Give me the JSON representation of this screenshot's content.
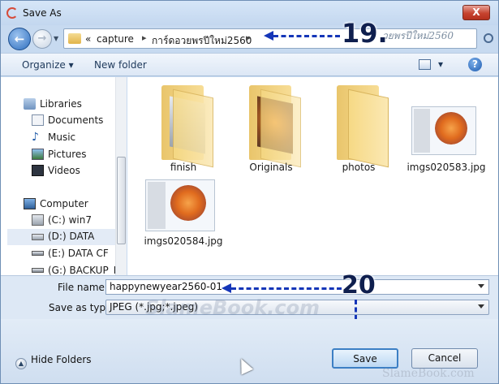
{
  "window": {
    "title": "Save As",
    "close_label": "X"
  },
  "address": {
    "history_chevron": "«",
    "crumbs": [
      "capture",
      "การ์ดอวยพรปีใหม่2560"
    ],
    "separator": "▸",
    "search_text": "วยพรปีใหม่2560"
  },
  "toolbar": {
    "organize": "Organize ▾",
    "new_folder": "New folder",
    "help": "?"
  },
  "nav": {
    "libraries": "Libraries",
    "documents": "Documents",
    "music": "Music",
    "pictures": "Pictures",
    "videos": "Videos",
    "computer": "Computer",
    "drive_c": "(C:) win7",
    "drive_d": "(D:) DATA",
    "drive_e": "(E:) DATA CF",
    "drive_g": "(G:) BACKUP_DI"
  },
  "files": [
    {
      "label": "finish"
    },
    {
      "label": "Originals"
    },
    {
      "label": "photos"
    },
    {
      "label": "imgs020583.jpg"
    },
    {
      "label": "imgs020584.jpg"
    }
  ],
  "fields": {
    "file_name_label": "File name:",
    "file_name_value": "happynewyear2560-01",
    "save_type_label": "Save as type:",
    "save_type_value": "JPEG (*.jpg;*.jpeg)"
  },
  "footer": {
    "hide_folders": "Hide Folders",
    "save": "Save",
    "cancel": "Cancel"
  },
  "annotations": {
    "step1": "19.",
    "step2": "20"
  },
  "watermarks": {
    "center": "SlameBook.com",
    "corner": "SlameBook.com"
  },
  "colors": {
    "annotation_arrow": "#1536b8",
    "close": "#c6432f"
  }
}
